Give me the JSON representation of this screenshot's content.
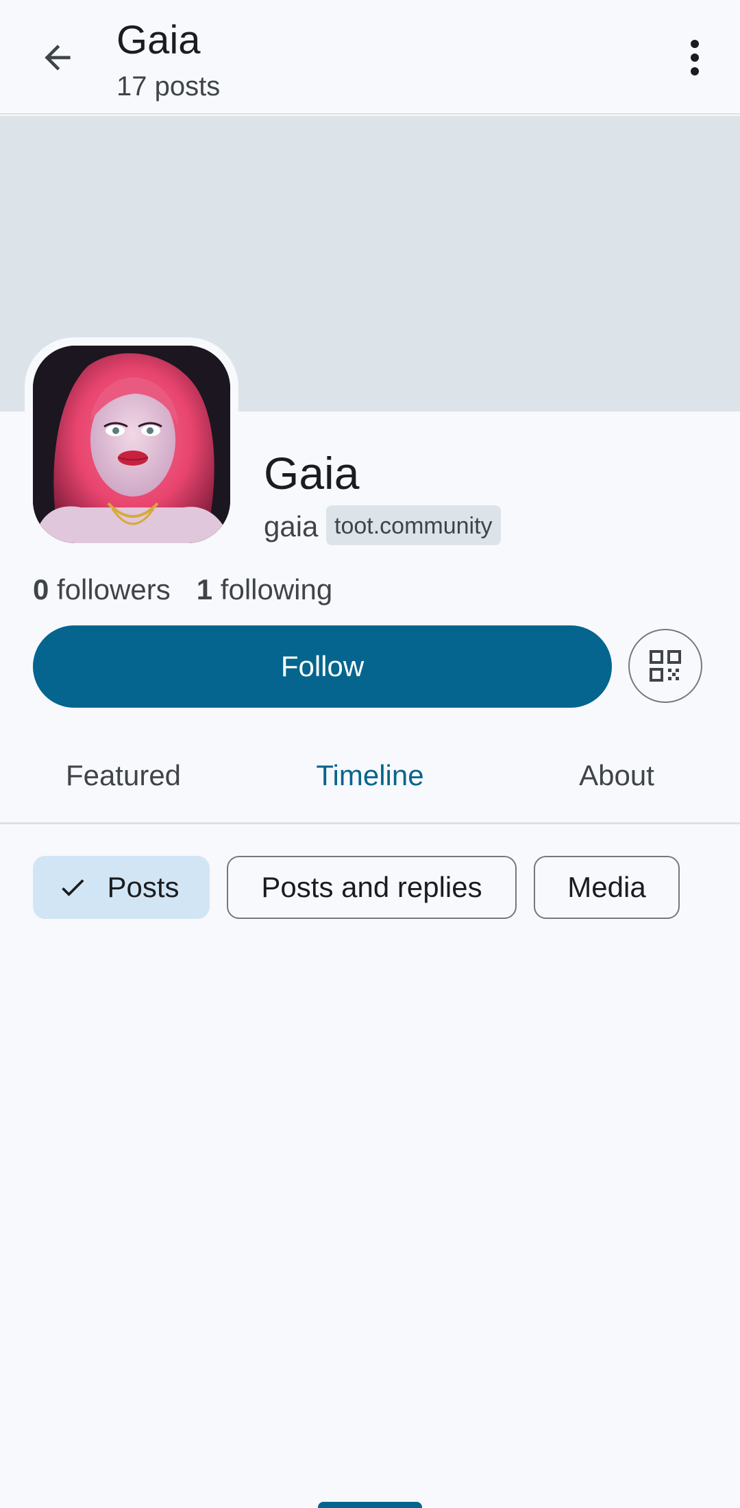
{
  "header": {
    "title": "Gaia",
    "subtitle": "17 posts"
  },
  "profile": {
    "display_name": "Gaia",
    "username": "gaia",
    "instance": "toot.community",
    "followers_count": "0",
    "followers_label": "followers",
    "following_count": "1",
    "following_label": "following"
  },
  "actions": {
    "follow_label": "Follow"
  },
  "tabs": [
    {
      "label": "Featured",
      "active": false
    },
    {
      "label": "Timeline",
      "active": true
    },
    {
      "label": "About",
      "active": false
    }
  ],
  "filters": [
    {
      "label": "Posts",
      "selected": true
    },
    {
      "label": "Posts and replies",
      "selected": false
    },
    {
      "label": "Media",
      "selected": false
    }
  ],
  "colors": {
    "accent": "#05658e",
    "banner": "#dce3e9",
    "selected_chip": "#d2e5f5"
  },
  "icons": [
    "arrow-back-icon",
    "more-vert-icon",
    "qr-code-icon",
    "check-icon"
  ]
}
